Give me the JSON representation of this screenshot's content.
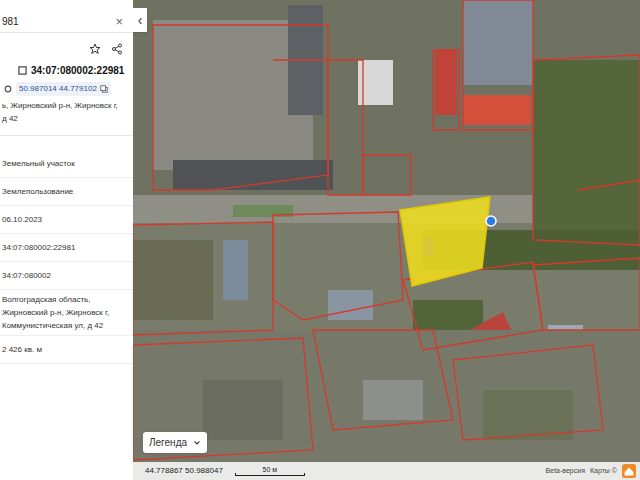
{
  "search": {
    "value": "981",
    "clear": "×"
  },
  "collapse": "‹",
  "parcel": {
    "number": "34:07:080002:22981",
    "coords": "50.987014 44.779102",
    "address_short": [
      "ь, Жирновский р-н, Жирновск г,",
      "д 42"
    ],
    "fields": [
      {
        "value": "Земельный участок"
      },
      {
        "value": "Землепользование"
      },
      {
        "value": "06.10.2023"
      },
      {
        "value": "34:07:080002:22981"
      },
      {
        "value": "34:07:080002"
      },
      {
        "value": "Волгоградская область, Жирновский р-н, Жирновск г, Коммунистическая ул, д 42"
      },
      {
        "value": "2 426 кв. м"
      }
    ]
  },
  "map": {
    "legend": "Легенда",
    "cursor_coords": "44.778867 50.988047",
    "scale": "50 м",
    "beta": "Beta-версия",
    "attribution": "Карты ©"
  }
}
